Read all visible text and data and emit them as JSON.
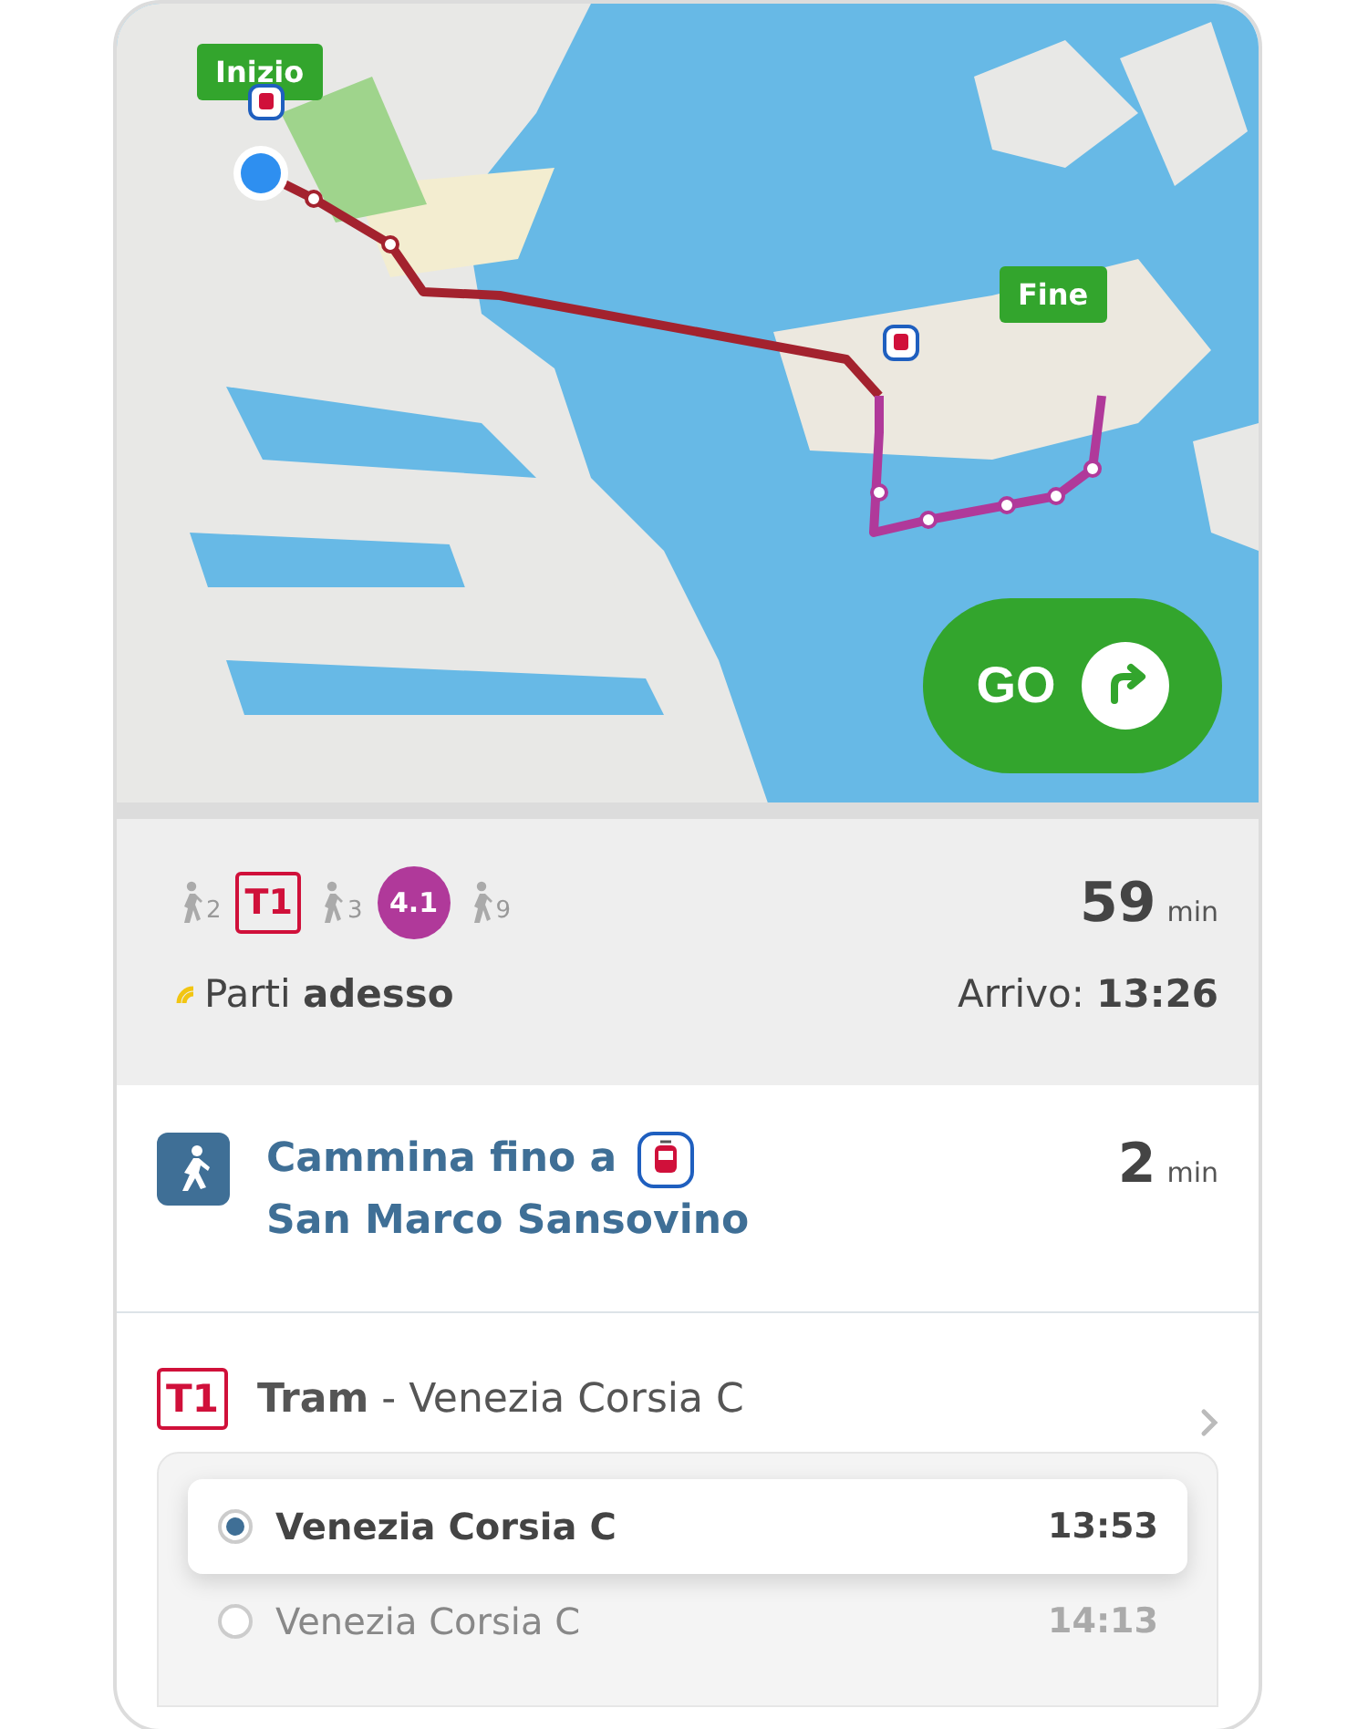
{
  "map": {
    "start_label": "Inizio",
    "end_label": "Fine",
    "go_button": "GO"
  },
  "summary": {
    "legs": [
      {
        "kind": "walk",
        "minutes": "2"
      },
      {
        "kind": "tram",
        "label": "T1",
        "color": "#d0103a"
      },
      {
        "kind": "walk",
        "minutes": "3"
      },
      {
        "kind": "boat",
        "label": "4.1",
        "color": "#b0399a"
      },
      {
        "kind": "walk",
        "minutes": "9"
      }
    ],
    "duration": "59",
    "duration_unit": "min",
    "departure": "Parti **adesso**",
    "arrival": "Arrivo: **13:26**"
  },
  "walk_step": {
    "text_before": "Cammina fino a",
    "stop": "San Marco Sansovino",
    "duration": "2",
    "duration_unit": "min"
  },
  "tram_step": {
    "badge": "T1",
    "color": "#d0103a",
    "title": "**Tram** - Venezia Corsia C",
    "departures": [
      {
        "destination": "Venezia Corsia C",
        "time": "13:53",
        "selected": true
      },
      {
        "destination": "Venezia Corsia C",
        "time": "14:13",
        "selected": false
      }
    ]
  }
}
